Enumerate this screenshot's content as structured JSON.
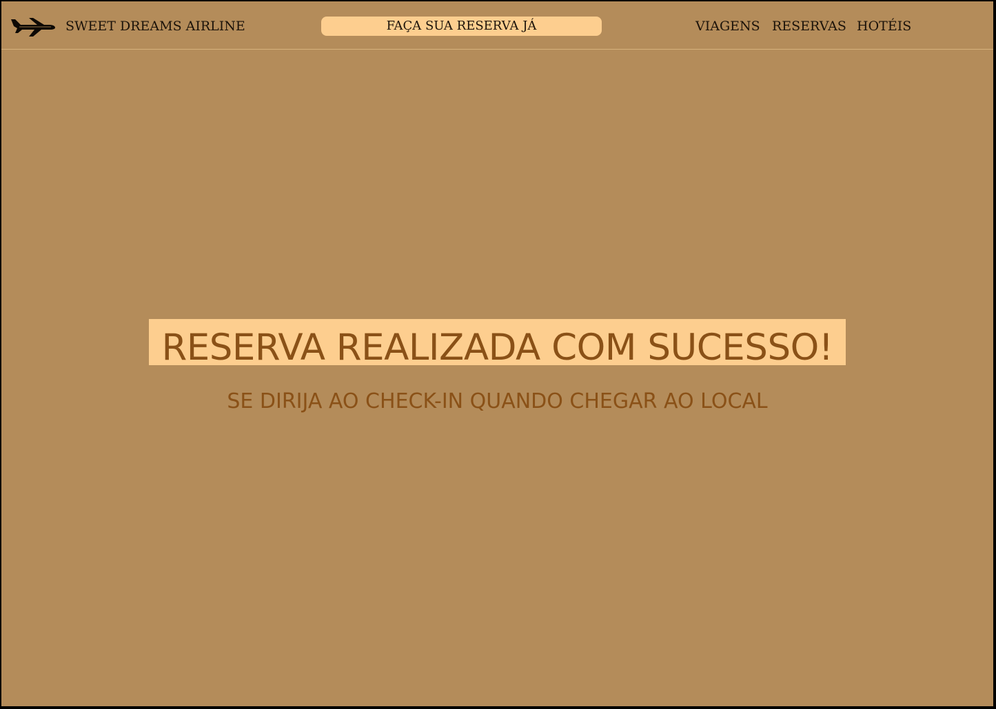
{
  "header": {
    "logo_icon": "airplane-icon",
    "brand": "SWEET DREAMS AIRLINE",
    "cta_label": "FAÇA SUA RESERVA JÁ",
    "nav": [
      "VIAGENS",
      "RESERVAS",
      "HOTÉIS"
    ]
  },
  "main": {
    "headline": "RESERVA REALIZADA COM SUCESSO!",
    "subline": "SE DIRIJA AO CHECK-IN QUANDO CHEGAR AO LOCAL"
  },
  "colors": {
    "background": "#b48c5a",
    "accent_panel": "#fdce8f",
    "headline_text": "#8a5117",
    "nav_text": "#1c130a",
    "border": "#000000"
  }
}
